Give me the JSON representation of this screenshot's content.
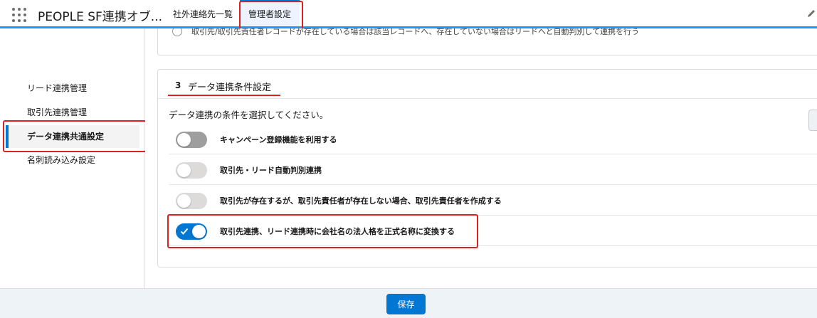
{
  "header": {
    "app_name": "PEOPLE SF連携オブ...",
    "tabs": [
      {
        "label": "社外連絡先一覧"
      },
      {
        "label": "管理者設定"
      }
    ]
  },
  "sidebar": {
    "items": [
      {
        "label": "リード連携管理"
      },
      {
        "label": "取引先連携管理"
      },
      {
        "label": "データ連携共通設定"
      },
      {
        "label": "名刺読み込み設定"
      }
    ]
  },
  "main": {
    "previous_option_label": "取引先/取引先責任者レコードが存在している場合は該当レコードへ、存在していない場合はリードへと自動判別して連携を行う",
    "section": {
      "number": "3",
      "title": "データ連携条件設定",
      "intro": "データ連携の条件を選択してください。",
      "settings": [
        {
          "label": "キャンペーン登録機能を利用する",
          "state": "off"
        },
        {
          "label": "取引先・リード自動判別連携",
          "state": "off-disabled"
        },
        {
          "label": "取引先が存在するが、取引先責任者が存在しない場合、取引先責任者を作成する",
          "state": "off-disabled"
        },
        {
          "label": "取引先連携、リード連携時に会社名の法人格を正式名称に変換する",
          "state": "on"
        }
      ]
    }
  },
  "footer": {
    "save_label": "保存"
  },
  "colors": {
    "brand_blue": "#0176d3",
    "highlight_red": "#e02020"
  },
  "icons": [
    "app-launcher-icon",
    "edit-pencil-icon",
    "checkmark-icon",
    "collapse-handle-icon"
  ]
}
